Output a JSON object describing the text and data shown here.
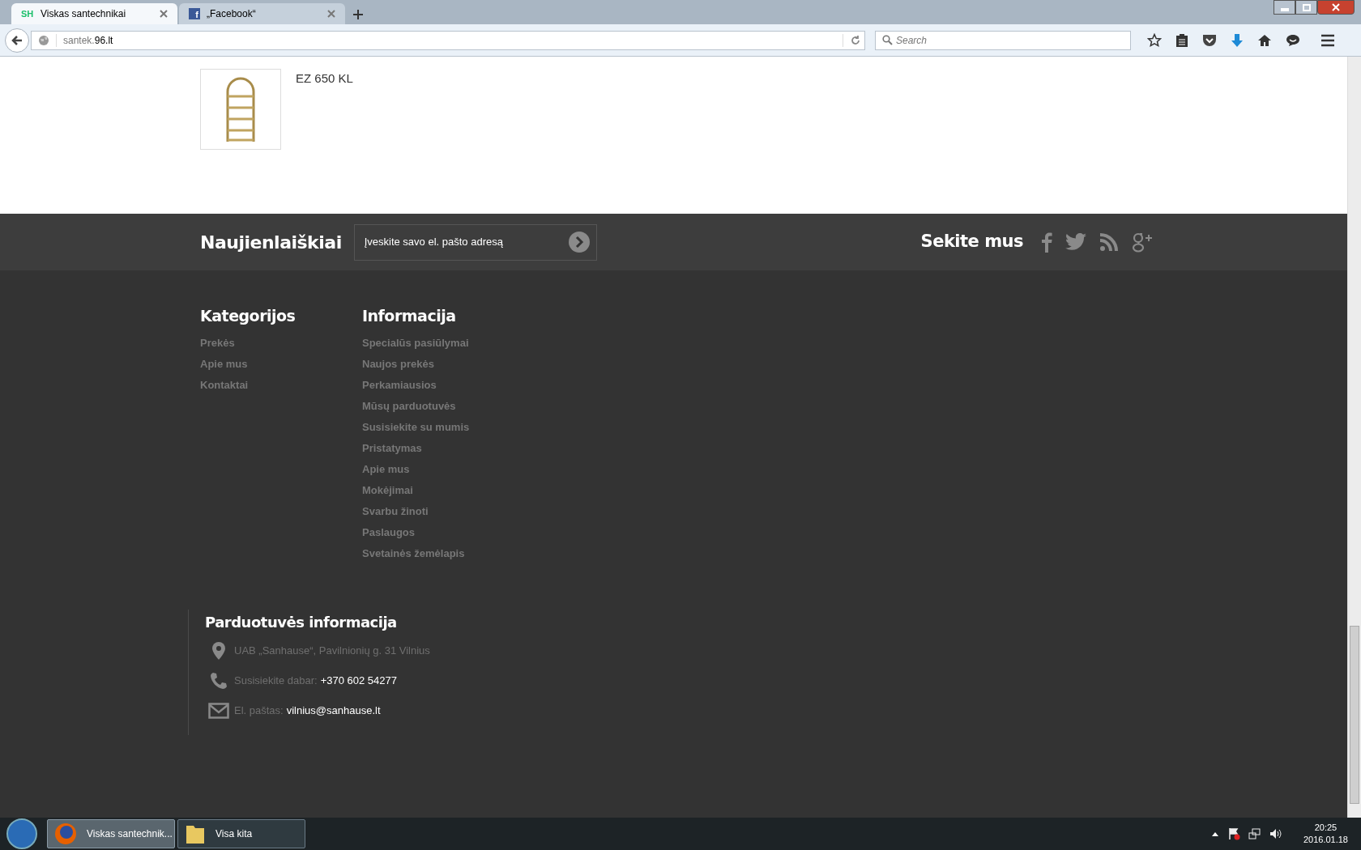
{
  "browser": {
    "tabs": [
      {
        "title": "Viskas santechnikai",
        "selected": true,
        "icon": "SH"
      },
      {
        "title": "„Facebook“",
        "selected": false,
        "icon": "f"
      }
    ],
    "address": {
      "host_prefix": "santek.",
      "host": "96.lt"
    },
    "search": {
      "placeholder": "Search"
    }
  },
  "product": {
    "name": "EZ 650 KL"
  },
  "newsletter": {
    "title": "Naujienlaiškiai",
    "placeholder": "Įveskite savo el. pašto adresą"
  },
  "follow": {
    "title": "Sekite mus",
    "networks": [
      {
        "kind": "facebook"
      },
      {
        "kind": "twitter"
      },
      {
        "kind": "rss"
      },
      {
        "kind": "googleplus"
      }
    ]
  },
  "categories": {
    "title": "Kategorijos",
    "items": [
      "Prekės",
      "Apie mus",
      "Kontaktai"
    ]
  },
  "information": {
    "title": "Informacija",
    "items": [
      "Specialūs pasiūlymai",
      "Naujos prekės",
      "Perkamiausios",
      "Mūsų parduotuvės",
      "Susisiekite su mumis",
      "Pristatymas",
      "Apie mus",
      "Mokėjimai",
      "Svarbu žinoti",
      "Paslaugos",
      "Svetainės žemėlapis"
    ]
  },
  "store_info": {
    "title": "Parduotuvės informacija",
    "rows": [
      {
        "kind": "address",
        "label": "UAB „Sanhause“, Pavilnionių g. 31 Vilnius"
      },
      {
        "kind": "phone",
        "label": "Susisiekite dabar:",
        "value": "+370 602 54277"
      },
      {
        "kind": "email",
        "label": "El. paštas:",
        "value": "vilnius@sanhause.lt"
      }
    ]
  },
  "taskbar": {
    "items": [
      {
        "title": "Viskas santechnik...",
        "kind": "firefox",
        "selected": true
      },
      {
        "title": "Visa kita",
        "kind": "folder",
        "selected": false
      }
    ],
    "time": "20:25",
    "date": "2016.01.18"
  }
}
